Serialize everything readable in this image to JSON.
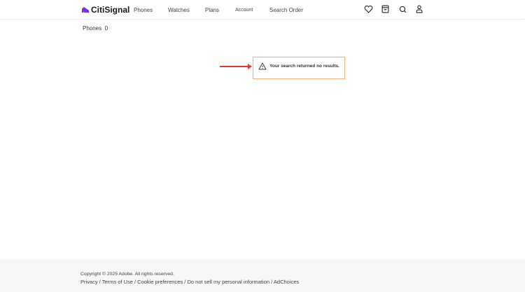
{
  "header": {
    "brand": "CitiSignal",
    "nav": [
      "Phones",
      "Watches",
      "Plans",
      "Account",
      "Search Order"
    ]
  },
  "breadcrumb": {
    "label": "Phones",
    "count": "0"
  },
  "alert": {
    "message": "Your search returned no results.",
    "border_color": "#f4b183"
  },
  "footer": {
    "copyright": "Copyright © 2025 Adobe. All rights reserved.",
    "links": [
      "Privacy",
      "Terms of Use",
      "Cookie preferences",
      "Do not sell my personal information",
      "AdChoices"
    ],
    "separator": " / "
  }
}
